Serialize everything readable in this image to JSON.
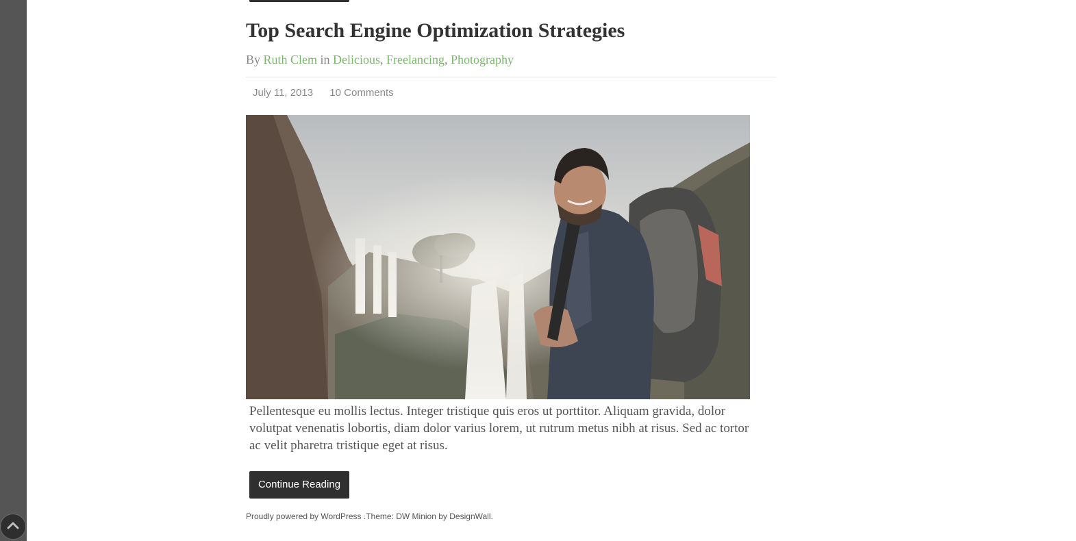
{
  "post": {
    "title": "Top Search Engine Optimization Strategies",
    "byline_by": "By",
    "author": "Ruth Clem",
    "byline_in": "in",
    "categories": [
      "Delicious",
      "Freelancing",
      "Photography"
    ],
    "date": "July 11, 2013",
    "comments": "10 Comments",
    "image_alt": "Smiling hiker with backpack in front of waterfalls",
    "excerpt": "Pellentesque eu mollis lectus. Integer tristique quis eros ut porttitor. Aliquam gravida, dolor volutpat venenatis lobortis, diam dolor varius lorem, ut rutrum metus nibh at risus. Sed ac tortor ac velit pharetra tristique eget at risus.",
    "continue_label": "Continue Reading"
  },
  "footer": {
    "prefix": "Proudly powered by",
    "wordpress": "WordPress",
    "theme_text": " .Theme: DW Minion by",
    "designwall": "DesignWall",
    "suffix": "."
  },
  "icons": {
    "scroll_top": "chevron-up-icon"
  },
  "colors": {
    "accent_link": "#79b86b",
    "button_bg": "#2f2f2f",
    "sidebar": "#555555"
  }
}
